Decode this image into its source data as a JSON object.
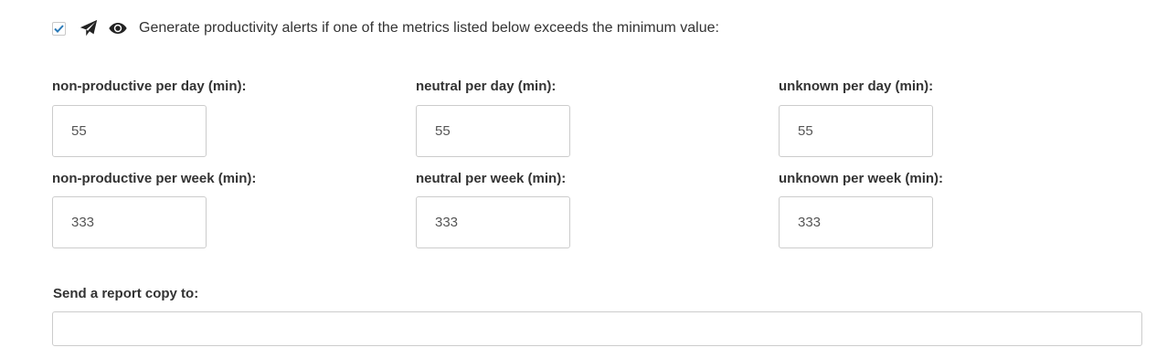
{
  "alerts": {
    "enabled": true,
    "send_icon": "paper-plane-icon",
    "view_icon": "eye-icon",
    "text": "Generate productivity alerts if one of the metrics listed below exceeds the minimum value:",
    "accent_color": "#2a7ab8"
  },
  "fields": {
    "nonproductive_day": {
      "label": "non-productive per day (min):",
      "value": "55"
    },
    "neutral_day": {
      "label": "neutral per day (min):",
      "value": "55"
    },
    "unknown_day": {
      "label": "unknown per day (min):",
      "value": "55"
    },
    "nonproductive_week": {
      "label": "non-productive per week (min):",
      "value": "333"
    },
    "neutral_week": {
      "label": "neutral per week (min):",
      "value": "333"
    },
    "unknown_week": {
      "label": "unknown per week (min):",
      "value": "333"
    }
  },
  "report": {
    "label": "Send a report copy to:",
    "value": ""
  }
}
